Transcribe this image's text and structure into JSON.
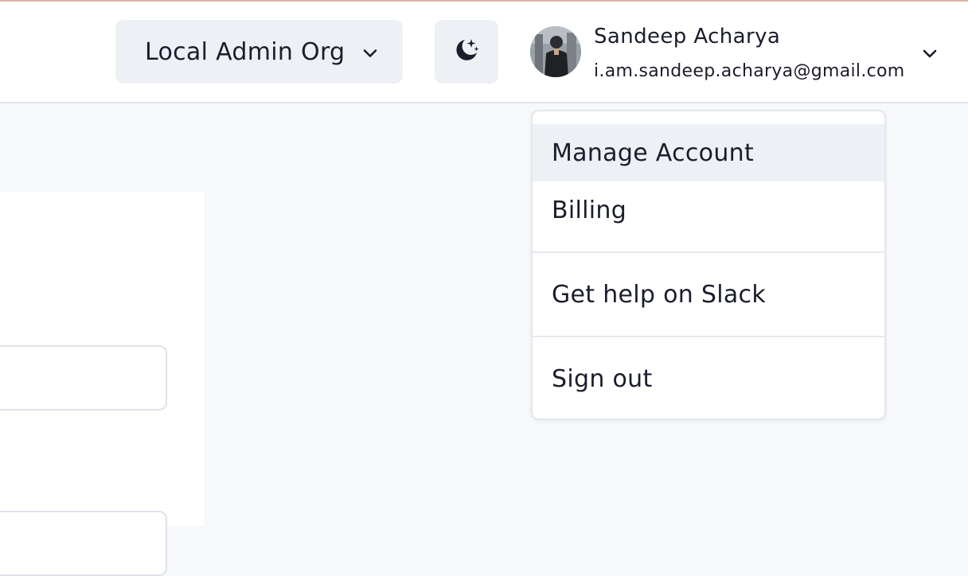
{
  "header": {
    "org_selector": {
      "label": "Local Admin Org",
      "icon": "chevron-down-icon"
    },
    "theme_toggle": {
      "icon": "moon-stars-icon"
    },
    "user": {
      "name": "Sandeep Acharya",
      "email": "i.am.sandeep.acharya@gmail.com",
      "avatar_icon": "avatar",
      "menu_icon": "chevron-down-icon"
    }
  },
  "user_dropdown": {
    "items": [
      {
        "label": "Manage Account",
        "highlighted": true
      },
      {
        "label": "Billing"
      },
      {
        "label": "Get help on Slack"
      },
      {
        "label": "Sign out"
      }
    ]
  },
  "colors": {
    "top_accent": "#dcb8a4",
    "button_bg": "#edf1f5",
    "page_bg": "#f7f8fa",
    "text": "#1a1d2b"
  }
}
